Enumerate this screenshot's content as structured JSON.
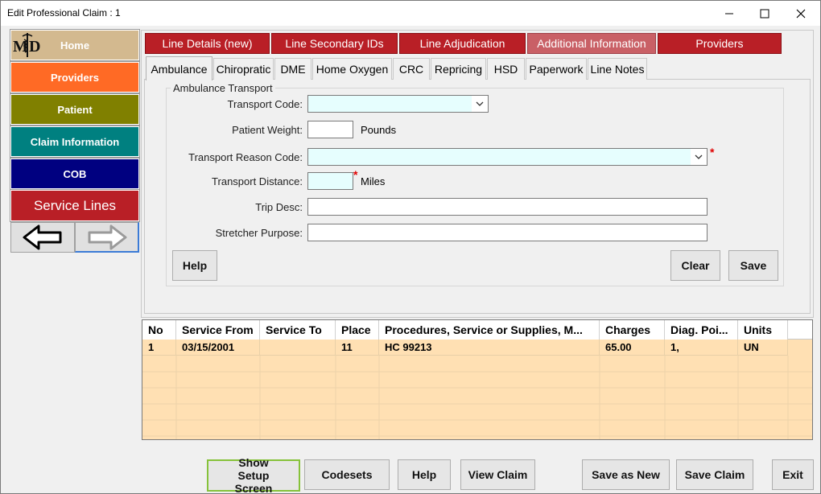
{
  "window": {
    "title": "Edit Professional Claim : 1"
  },
  "sidebar": {
    "logo_text": "MD",
    "items": [
      {
        "label": "Home",
        "color": "#d3b98f"
      },
      {
        "label": "Providers",
        "color": "#ff6a25"
      },
      {
        "label": "Patient",
        "color": "#808000"
      },
      {
        "label": "Claim Information",
        "color": "#008080"
      },
      {
        "label": "COB",
        "color": "#000080"
      },
      {
        "label": "Service Lines",
        "color": "#b91f26"
      }
    ]
  },
  "top_tabs": [
    "Line Details (new)",
    "Line Secondary IDs",
    "Line Adjudication",
    "Additional Information",
    "Providers"
  ],
  "sub_tabs": [
    "Ambulance",
    "Chiropratic",
    "DME",
    "Home Oxygen",
    "CRC",
    "Repricing",
    "HSD",
    "Paperwork",
    "Line Notes"
  ],
  "ambulance": {
    "group_title": "Ambulance Transport",
    "transport_code_label": "Transport Code:",
    "transport_code_value": "",
    "patient_weight_label": "Patient Weight:",
    "patient_weight_value": "",
    "pounds_label": "Pounds",
    "reason_code_label": "Transport Reason Code:",
    "reason_code_value": "",
    "distance_label": "Transport Distance:",
    "distance_value": "",
    "miles_label": "Miles",
    "trip_desc_label": "Trip Desc:",
    "trip_desc_value": "",
    "stretcher_label": "Stretcher Purpose:",
    "stretcher_value": "",
    "required_mark": "*",
    "help_label": "Help",
    "clear_label": "Clear",
    "save_label": "Save"
  },
  "grid": {
    "columns": [
      "No",
      "Service From",
      "Service To",
      "Place",
      "Procedures, Service or Supplies, M...",
      "Charges",
      "Diag. Poi...",
      "Units"
    ],
    "rows": [
      [
        "1",
        "03/15/2001",
        "",
        "11",
        "HC 99213",
        "65.00",
        "1,",
        "UN"
      ]
    ]
  },
  "footer": {
    "setup_label": "Show Setup Screen",
    "codesets_label": "Codesets",
    "help_label": "Help",
    "view_claim_label": "View Claim",
    "save_as_new_label": "Save as New",
    "save_claim_label": "Save Claim",
    "exit_label": "Exit"
  }
}
